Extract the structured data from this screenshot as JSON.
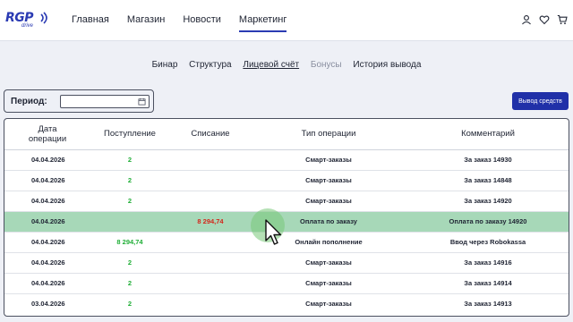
{
  "brand": {
    "logo_main": "RGP",
    "logo_sub": "drive",
    "primary": "#2030a8",
    "success": "#1fae36",
    "danger": "#d4261b",
    "selected_row": "#a7d8b8"
  },
  "nav": [
    {
      "label": "Главная"
    },
    {
      "label": "Магазин"
    },
    {
      "label": "Новости"
    },
    {
      "label": "Маркетинг"
    }
  ],
  "header_icons": [
    "user-icon",
    "heart-icon",
    "cart-icon"
  ],
  "subtabs": [
    {
      "label": "Бинар"
    },
    {
      "label": "Структура"
    },
    {
      "label": "Лицевой счёт"
    },
    {
      "label": "Бонусы"
    },
    {
      "label": "История вывода"
    }
  ],
  "filter": {
    "period_label": "Период:",
    "period_value": ""
  },
  "withdraw_button": "Вывод средств",
  "table": {
    "headers": {
      "date": "Дата операции",
      "income": "Поступление",
      "expense": "Списание",
      "type": "Тип операции",
      "comment": "Комментарий"
    },
    "rows": [
      {
        "date": "04.04.2026",
        "income": "2",
        "expense": "",
        "type": "Смарт-заказы",
        "comment": "За заказ 14930"
      },
      {
        "date": "04.04.2026",
        "income": "2",
        "expense": "",
        "type": "Смарт-заказы",
        "comment": "За заказ 14848"
      },
      {
        "date": "04.04.2026",
        "income": "2",
        "expense": "",
        "type": "Смарт-заказы",
        "comment": "За заказ 14920"
      },
      {
        "date": "04.04.2026",
        "income": "",
        "expense": "8 294,74",
        "type": "Оплата по заказу",
        "comment": "Оплата по заказу 14920"
      },
      {
        "date": "04.04.2026",
        "income": "8 294,74",
        "expense": "",
        "type": "Онлайн пополнение",
        "comment": "Ввод через Robokassa"
      },
      {
        "date": "04.04.2026",
        "income": "2",
        "expense": "",
        "type": "Смарт-заказы",
        "comment": "За заказ 14916"
      },
      {
        "date": "04.04.2026",
        "income": "2",
        "expense": "",
        "type": "Смарт-заказы",
        "comment": "За заказ 14914"
      },
      {
        "date": "03.04.2026",
        "income": "2",
        "expense": "",
        "type": "Смарт-заказы",
        "comment": "За заказ 14913"
      }
    ]
  }
}
